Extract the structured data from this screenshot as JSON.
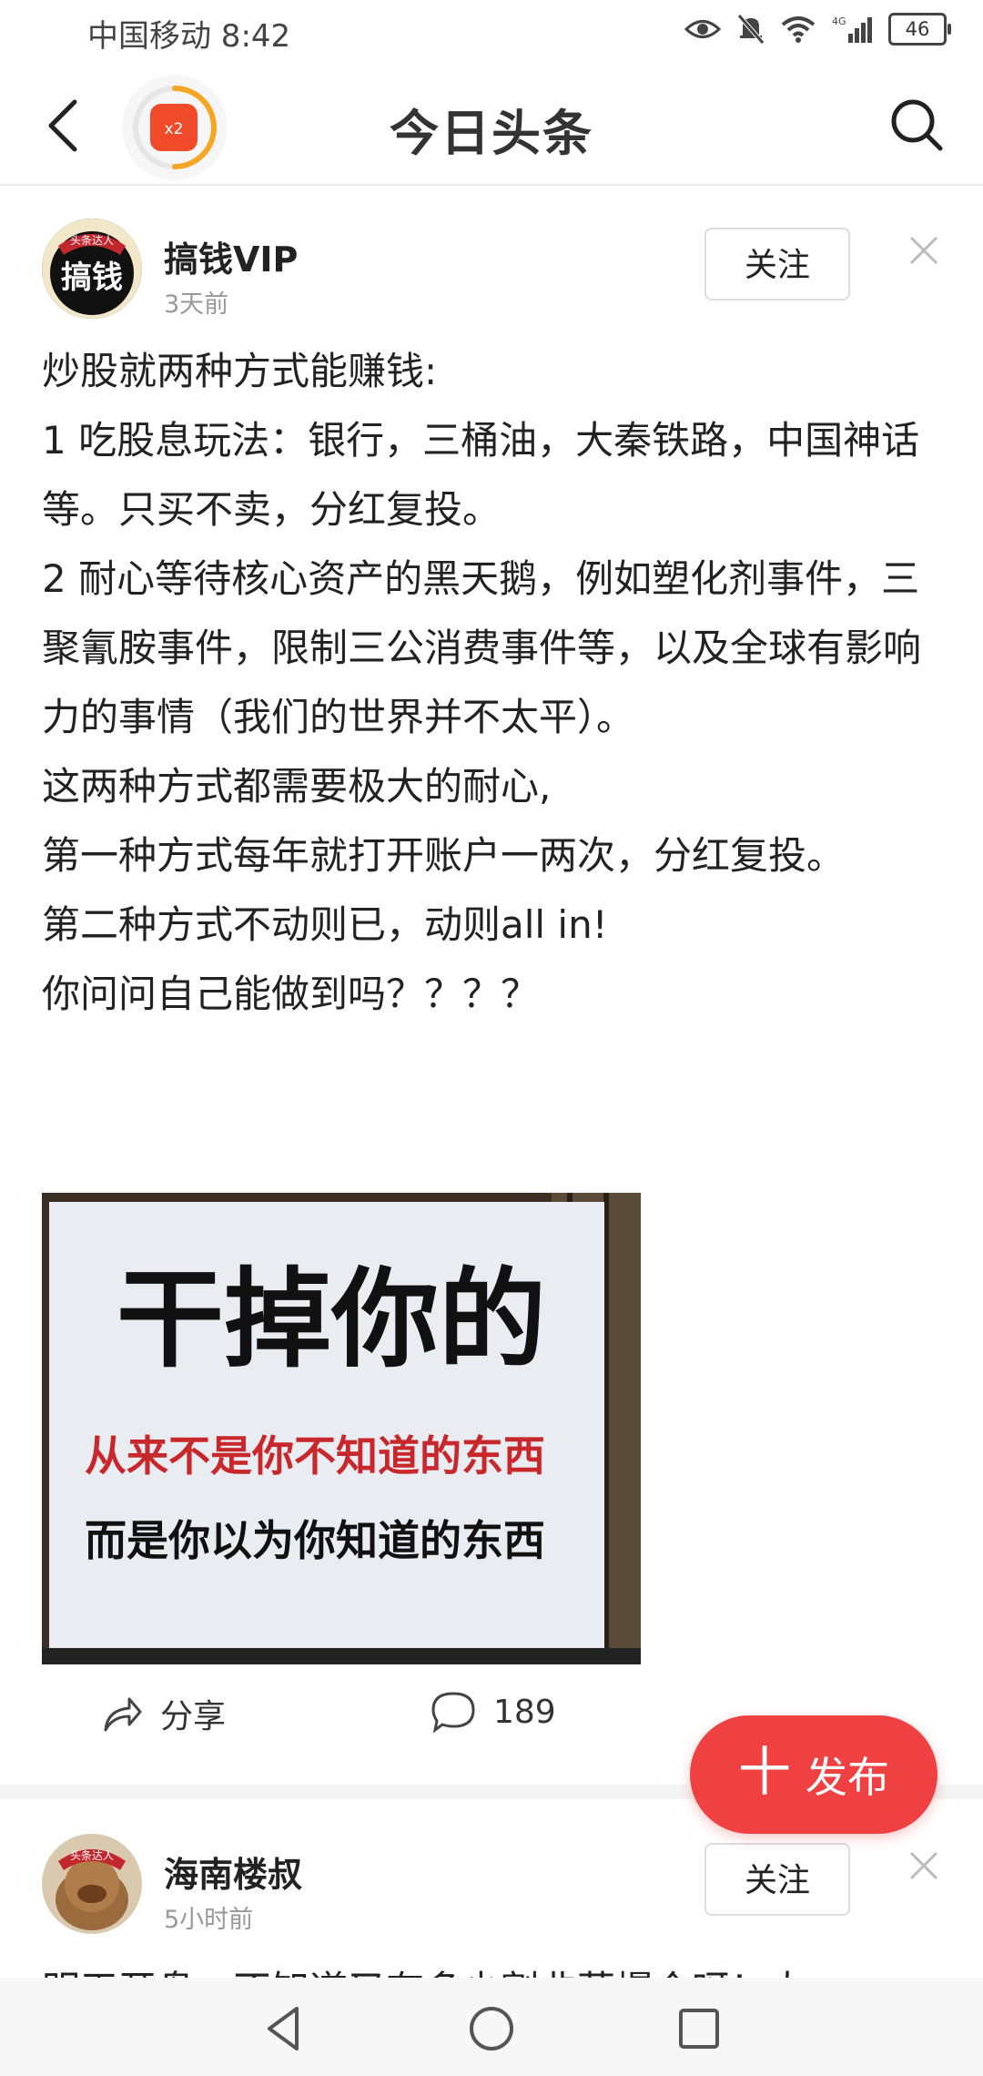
{
  "status_bar": {
    "carrier_time": "中国移动 8:42",
    "battery": "46"
  },
  "top_nav": {
    "title": "今日头条",
    "redpacket_badge": "x2"
  },
  "posts": [
    {
      "avatar_text": "搞钱",
      "avatar_tag": "头条达人",
      "author": "搞钱VIP",
      "time": "3天前",
      "follow_label": "关注",
      "body": [
        "炒股就两种方式能赚钱:",
        "1 吃股息玩法：银行，三桶油，大秦铁路，中国神话等。只买不卖，分红复投。",
        "2 耐心等待核心资产的黑天鹅，例如塑化剂事件，三聚氰胺事件，限制三公消费事件等，以及全球有影响力的事情（我们的世界并不太平）。",
        "这两种方式都需要极大的耐心,",
        "第一种方式每年就打开账户一两次，分红复投。",
        "第二种方式不动则已，动则all in!",
        "你问问自己能做到吗？？？？"
      ],
      "image": {
        "headline": "干掉你的",
        "line1": "从来不是你不知道的东西",
        "line2": "而是你以为你知道的东西"
      },
      "share_label": "分享",
      "comment_count": "189"
    },
    {
      "avatar_tag": "头条达人",
      "author": "海南楼叔",
      "time": "5小时前",
      "follow_label": "关注",
      "body_preview": "明天开盘，不知道又有多少割韭菜爆仓呀！大"
    }
  ],
  "fab": {
    "plus": "十",
    "label": "发布"
  },
  "colors": {
    "accent_red": "#f04142",
    "redpacket": "#f04a2a",
    "ring": "#f5a623"
  }
}
